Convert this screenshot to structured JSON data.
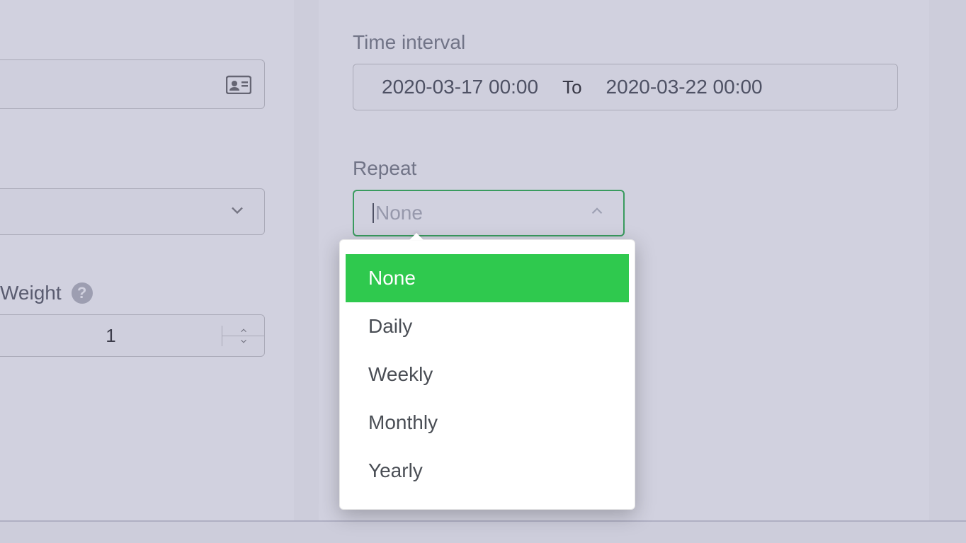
{
  "left": {
    "weight_label": "Weight",
    "weight_value": "1"
  },
  "right": {
    "time_interval_label": "Time interval",
    "time_from": "2020-03-17 00:00",
    "time_to_label": "To",
    "time_to": "2020-03-22 00:00",
    "repeat_label": "Repeat",
    "repeat_placeholder": "None"
  },
  "repeat_options": [
    "None",
    "Daily",
    "Weekly",
    "Monthly",
    "Yearly"
  ],
  "repeat_selected_index": 0
}
